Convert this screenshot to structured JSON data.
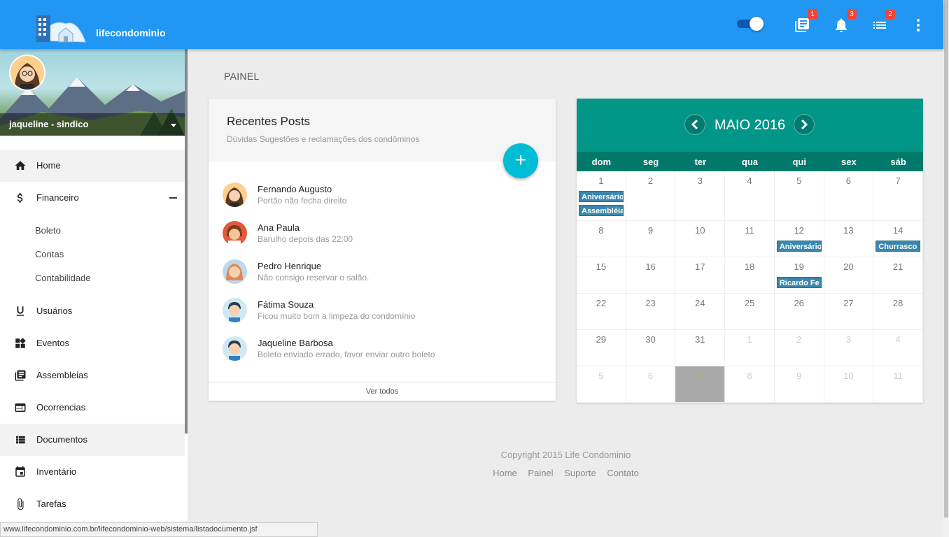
{
  "app": {
    "brand": "lifecondominio"
  },
  "topbar": {
    "badges": {
      "assembleias": "1",
      "notifications": "3",
      "list": "2"
    }
  },
  "profile": {
    "name": "jaqueline - sindico"
  },
  "sidebar": {
    "items": [
      {
        "label": "Home"
      },
      {
        "label": "Financeiro"
      },
      {
        "label": "Usuários"
      },
      {
        "label": "Eventos"
      },
      {
        "label": "Assembleias"
      },
      {
        "label": "Ocorrencias"
      },
      {
        "label": "Documentos"
      },
      {
        "label": "Inventário"
      },
      {
        "label": "Tarefas"
      }
    ],
    "financeiro_sub": [
      "Boleto",
      "Contas",
      "Contabilidade"
    ]
  },
  "main": {
    "title": "PAINEL"
  },
  "posts_card": {
    "title": "Recentes Posts",
    "subtitle": "Dúvidas Sugestões e reclamações dos condôminos",
    "fab": "+",
    "footer": "Ver todos",
    "posts": [
      {
        "name": "Fernando Augusto",
        "message": "Portão não fecha direito"
      },
      {
        "name": "Ana Paula",
        "message": "Barulho depois das 22:00"
      },
      {
        "name": "Pedro Henrique",
        "message": "Não consigo reservar o salão."
      },
      {
        "name": "Fátima Souza",
        "message": "Ficou muito bom a limpeza do condomínio"
      },
      {
        "name": "Jaqueline Barbosa",
        "message": "Boleto enviado errado, favor enviar outro boleto"
      }
    ]
  },
  "calendar": {
    "month": "MAIO 2016",
    "weekdays": [
      "dom",
      "seg",
      "ter",
      "qua",
      "qui",
      "sex",
      "sáb"
    ],
    "weeks": [
      [
        "1",
        "2",
        "3",
        "4",
        "5",
        "6",
        "7"
      ],
      [
        "8",
        "9",
        "10",
        "11",
        "12",
        "13",
        "14"
      ],
      [
        "15",
        "16",
        "17",
        "18",
        "19",
        "20",
        "21"
      ],
      [
        "22",
        "23",
        "24",
        "25",
        "26",
        "27",
        "28"
      ],
      [
        "29",
        "30",
        "31",
        "1",
        "2",
        "3",
        "4"
      ],
      [
        "5",
        "6",
        "7",
        "8",
        "9",
        "10",
        "11"
      ]
    ],
    "events": [
      {
        "week": 0,
        "day": 0,
        "slot": 0,
        "label": "Aniversário"
      },
      {
        "week": 0,
        "day": 0,
        "slot": 1,
        "label": "Assembléia"
      },
      {
        "week": 1,
        "day": 4,
        "slot": 0,
        "label": "Aniversário"
      },
      {
        "week": 1,
        "day": 6,
        "slot": 0,
        "label": "Churrasco"
      },
      {
        "week": 2,
        "day": 4,
        "slot": 0,
        "label": "Ricardo Fe"
      }
    ]
  },
  "footer": {
    "copyright": "Copyright 2015 Life Condominio",
    "links": [
      "Home",
      "Painel",
      "Suporte",
      "Contato"
    ]
  },
  "statusbar": {
    "url": "www.lifecondominio.com.br/lifecondominio-web/sistema/listadocumento.jsf"
  }
}
